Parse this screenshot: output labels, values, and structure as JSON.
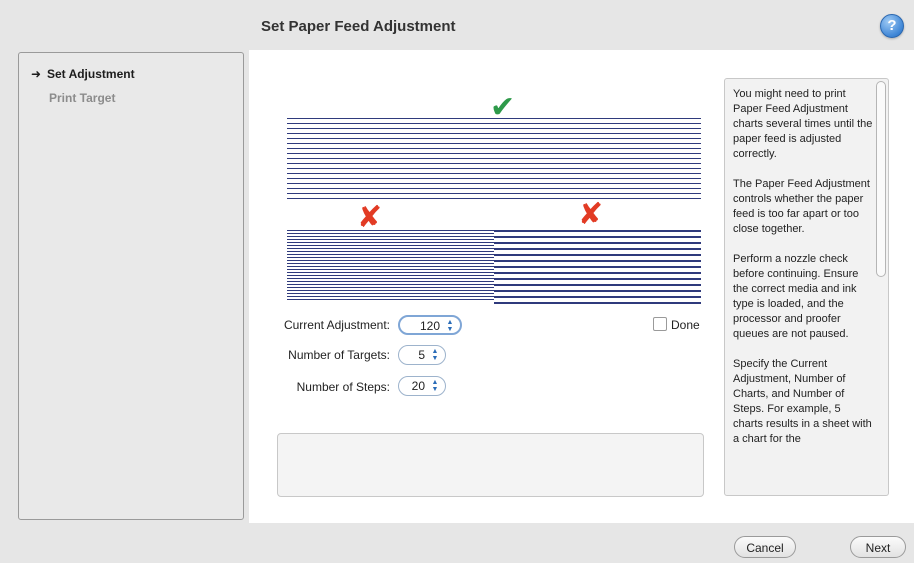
{
  "window": {
    "title": "Set Paper Feed Adjustment",
    "help_label": "?"
  },
  "sidebar": {
    "items": [
      {
        "label": "Set Adjustment",
        "marker": "➜"
      },
      {
        "label": "Print Target"
      }
    ]
  },
  "chart": {
    "check": "✔",
    "cross_left": "✘",
    "cross_right": "✘"
  },
  "form": {
    "current_adjustment_label": "Current Adjustment:",
    "current_adjustment_value": "120",
    "number_of_targets_label": "Number of Targets:",
    "number_of_targets_value": "5",
    "number_of_steps_label": "Number of Steps:",
    "number_of_steps_value": "20",
    "done_label": "Done",
    "done_checked": false
  },
  "info": {
    "paragraphs": [
      "You might need to print Paper Feed Adjustment charts several times until the paper feed is adjusted correctly.",
      "The Paper Feed Adjustment controls whether the paper feed is too far apart or too close together.",
      "Perform a nozzle check before continuing. Ensure the correct media and ink type is loaded, and the processor and proofer queues are not paused.",
      "Specify the Current Adjustment, Number of Charts, and Number of Steps. For example, 5 charts results in a sheet with a chart for the"
    ]
  },
  "footer": {
    "cancel_label": "Cancel",
    "next_label": "Next"
  }
}
